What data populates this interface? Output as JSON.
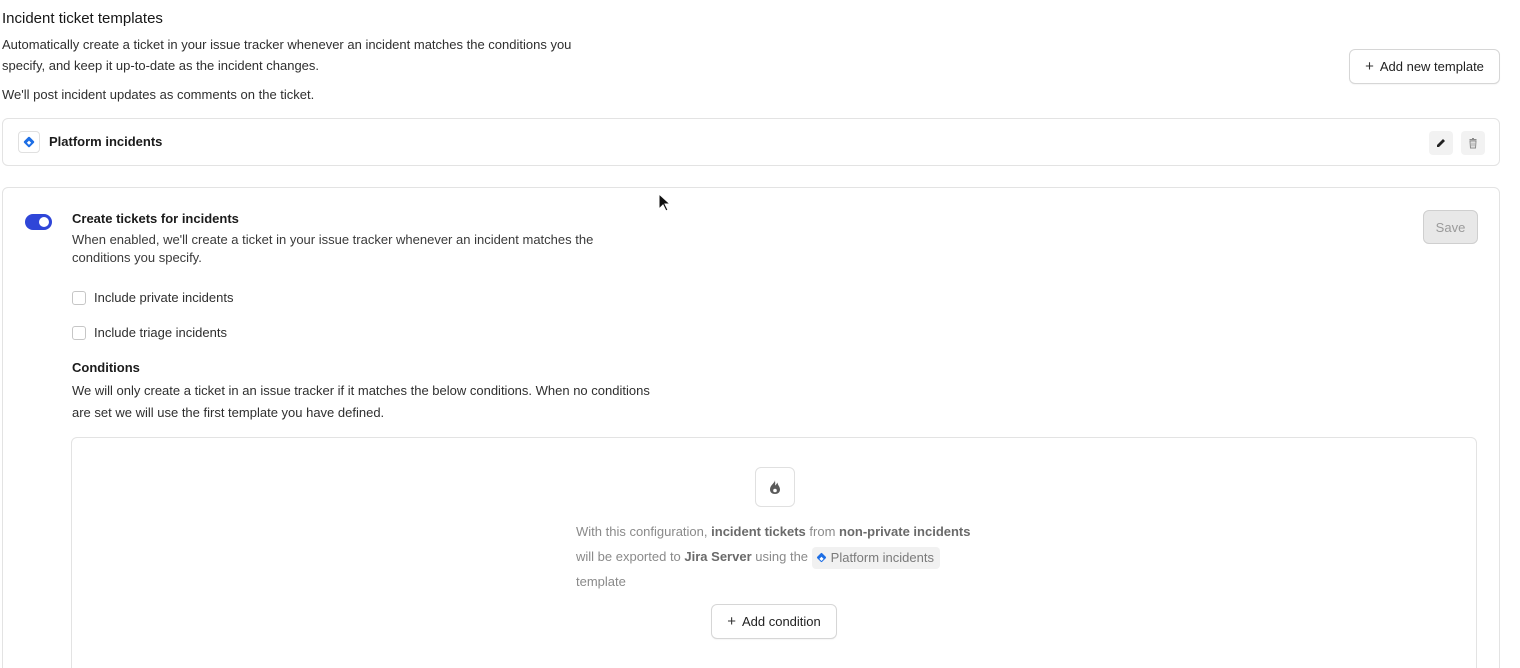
{
  "header": {
    "title": "Incident ticket templates",
    "description": "Automatically create a ticket in your issue tracker whenever an incident matches the conditions you specify, and keep it up-to-date as the incident changes.",
    "description2": "We'll post incident updates as comments on the ticket.",
    "add_template_label": "Add new template"
  },
  "template": {
    "name": "Platform incidents",
    "icon": "jira-icon"
  },
  "config": {
    "toggle_enabled": true,
    "title": "Create tickets for incidents",
    "description": "When enabled, we'll create a ticket in your issue tracker whenever an incident matches the conditions you specify.",
    "save_label": "Save",
    "checkbox_private": "Include private incidents",
    "checkbox_triage": "Include triage incidents",
    "conditions_title": "Conditions",
    "conditions_desc": "We will only create a ticket in an issue tracker if it matches the below conditions. When no conditions are set we will use the first template you have defined."
  },
  "summary": {
    "part1": "With this configuration,",
    "bold1": "incident tickets",
    "part2": "from",
    "bold2": "non-private incidents",
    "part3": "will be exported to",
    "bold3": "Jira Server",
    "part4": "using the",
    "pill_label": "Platform incidents",
    "part5": "template",
    "add_condition_label": "Add condition"
  },
  "colors": {
    "accent": "#2f46d8",
    "jira_blue": "#1d6ee5"
  }
}
